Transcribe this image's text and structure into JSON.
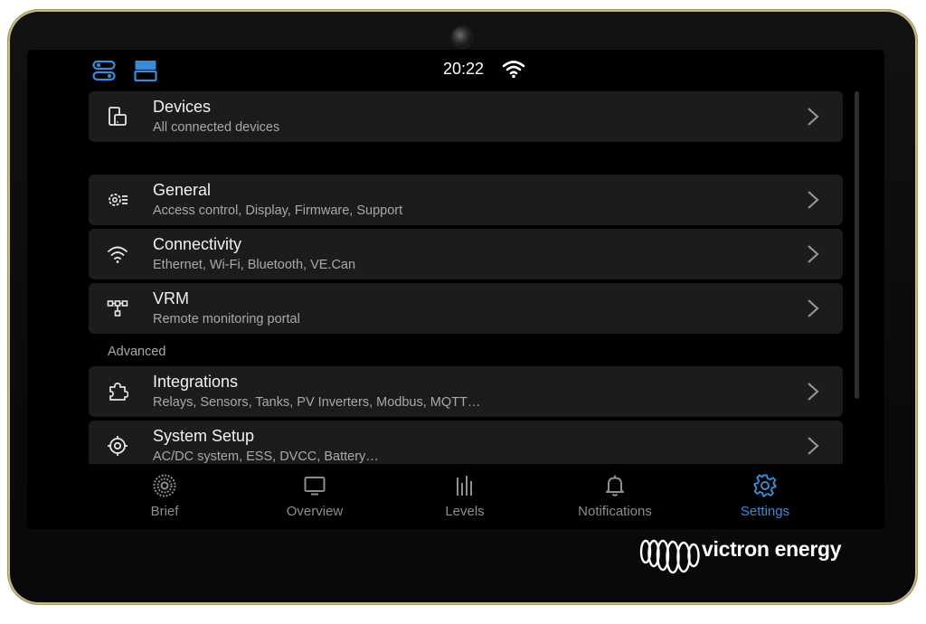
{
  "status_bar": {
    "time": "20:22",
    "left_icons": [
      "toggle-switches-icon",
      "layout-split-icon"
    ],
    "right_icons": [
      "wifi-icon"
    ],
    "accent_color": "#3a8bd6"
  },
  "settings_list": {
    "items": [
      {
        "title": "Devices",
        "subtitle": "All connected devices",
        "icon": "devices-icon"
      },
      {
        "title": "General",
        "subtitle": "Access control, Display, Firmware, Support",
        "icon": "gear-list-icon"
      },
      {
        "title": "Connectivity",
        "subtitle": "Ethernet, Wi-Fi, Bluetooth, VE.Can",
        "icon": "wifi-icon"
      },
      {
        "title": "VRM",
        "subtitle": "Remote monitoring portal",
        "icon": "network-nodes-icon"
      },
      {
        "title": "Integrations",
        "subtitle": "Relays, Sensors, Tanks, PV Inverters, Modbus, MQTT…",
        "icon": "puzzle-icon"
      },
      {
        "title": "System Setup",
        "subtitle": "AC/DC system, ESS, DVCC, Battery…",
        "icon": "target-icon"
      }
    ],
    "section_advanced": "Advanced"
  },
  "tab_bar": {
    "tabs": [
      {
        "label": "Brief",
        "icon": "brief-dial-icon",
        "active": false
      },
      {
        "label": "Overview",
        "icon": "monitor-icon",
        "active": false
      },
      {
        "label": "Levels",
        "icon": "levels-bars-icon",
        "active": false
      },
      {
        "label": "Notifications",
        "icon": "bell-icon",
        "active": false
      },
      {
        "label": "Settings",
        "icon": "gear-icon",
        "active": true
      }
    ],
    "active_color": "#3a8bd6",
    "inactive_color": "#8e8e8e"
  },
  "brand": {
    "name": "victron energy",
    "logo": "victron-logo"
  }
}
